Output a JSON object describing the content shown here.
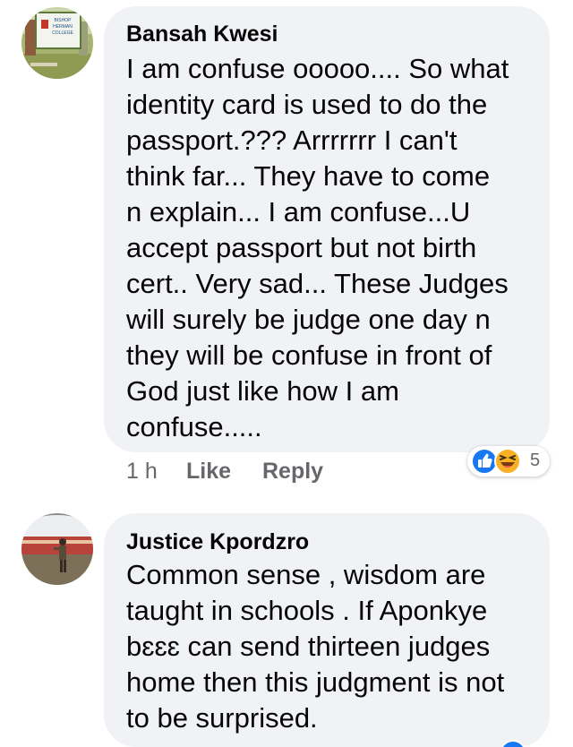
{
  "comments": [
    {
      "author": "Bansah Kwesi",
      "avatar_text": [
        "BISHOP",
        "HERMAN",
        "COLLEGE"
      ],
      "lines": [
        "I am confuse ooooo.... So what",
        "identity card is used to do the",
        "passport.??? Arrrrrrr I can't",
        "think far... They have to come",
        "n explain... I am confuse...U",
        "accept passport but not birth",
        "cert.. Very sad... These Judges",
        "will surely be judge one day n",
        "they will be confuse in front of",
        "God just like how I am",
        "confuse....."
      ],
      "time": "1 h",
      "like_label": "Like",
      "reply_label": "Reply",
      "reaction_count": "5",
      "reaction_icons": [
        "like-icon",
        "laughing-emoji-icon"
      ]
    },
    {
      "author": "Justice Kpordzro",
      "lines": [
        "Common sense , wisdom are",
        "taught in schools . If Aponkye",
        "bɛɛɛ can send thirteen judges",
        "home then this judgment is not",
        "to be surprised."
      ]
    }
  ],
  "colors": {
    "bubble": "#f0f2f5",
    "text": "#050505",
    "meta": "#65676b",
    "like_blue": "#1877f2",
    "haha_yellow": "#f7b125"
  }
}
